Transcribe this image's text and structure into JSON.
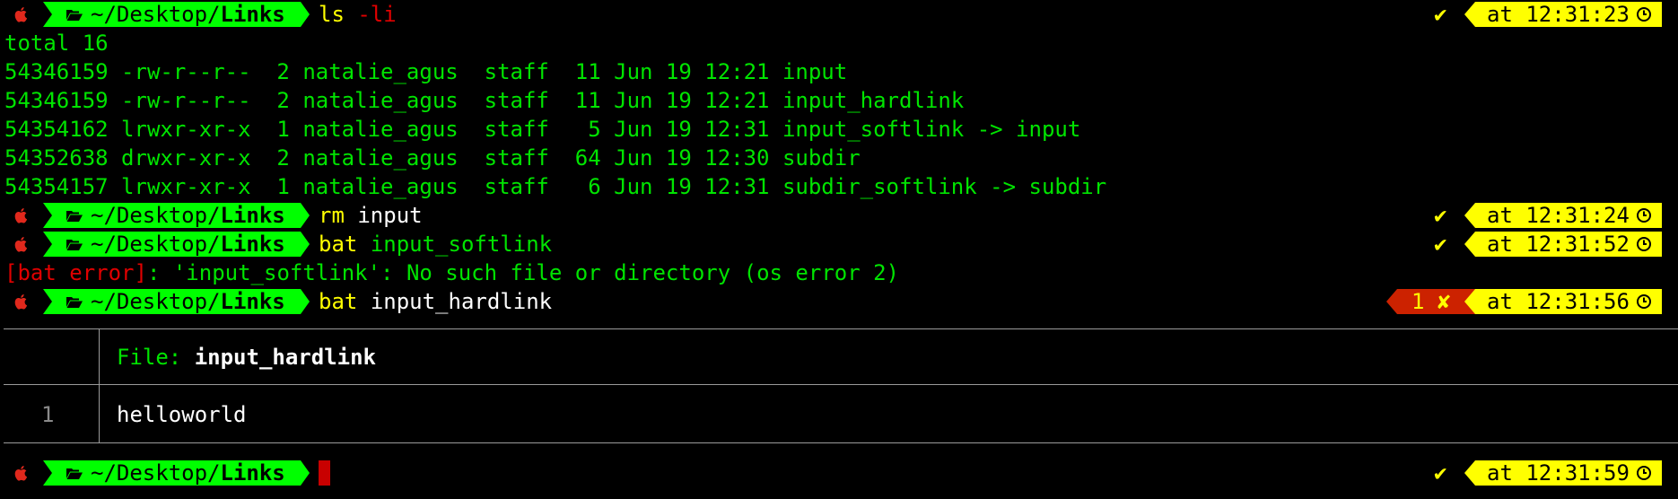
{
  "colors": {
    "prompt_green": "#00ff00",
    "time_yellow": "#ffff00",
    "error_red": "#cc2200",
    "text_green": "#00e400"
  },
  "prompt": {
    "path_prefix": "~/Desktop/",
    "path_dir": "Links",
    "apple_icon": "apple-icon",
    "folder_icon": "folder-open-icon"
  },
  "lines": {
    "cmd1": {
      "name": "ls",
      "args": "-li",
      "time": "at 12:31:23"
    },
    "total": "total 16",
    "ls_rows": [
      "54346159 -rw-r--r--  2 natalie_agus  staff  11 Jun 19 12:21 input",
      "54346159 -rw-r--r--  2 natalie_agus  staff  11 Jun 19 12:21 input_hardlink",
      "54354162 lrwxr-xr-x  1 natalie_agus  staff   5 Jun 19 12:31 input_softlink -> input",
      "54352638 drwxr-xr-x  2 natalie_agus  staff  64 Jun 19 12:30 subdir",
      "54354157 lrwxr-xr-x  1 natalie_agus  staff   6 Jun 19 12:31 subdir_softlink -> subdir"
    ],
    "cmd2": {
      "name": "rm",
      "args": "input",
      "time": "at 12:31:24"
    },
    "cmd3": {
      "name": "bat",
      "args": "input_softlink",
      "time": "at 12:31:52"
    },
    "bat_error": {
      "tag": "[bat error]",
      "message": ": 'input_softlink': No such file or directory (os error 2)"
    },
    "cmd4": {
      "name": "bat",
      "args": "input_hardlink",
      "time": "at 12:31:56",
      "exit_code": "1 ✘"
    },
    "file_header_label": "File: ",
    "file_header_name": "input_hardlink",
    "file_line_number": "1",
    "file_line_content": "helloworld",
    "cmd5": {
      "time": "at 12:31:59"
    }
  },
  "status": {
    "check_mark": "✔"
  }
}
